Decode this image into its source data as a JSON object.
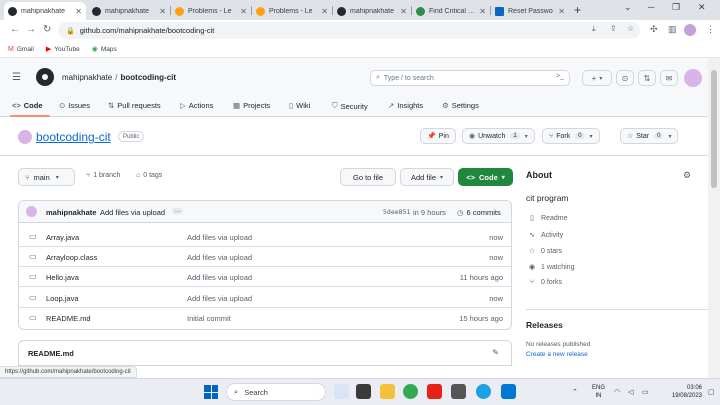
{
  "browser": {
    "tabs": [
      {
        "title": "mahipnakhate"
      },
      {
        "title": "mahipnakhate"
      },
      {
        "title": "Problems - Le"
      },
      {
        "title": "Problems - Le"
      },
      {
        "title": "mahipnakhate"
      },
      {
        "title": "Find Critical an"
      },
      {
        "title": "Reset Passwo"
      }
    ],
    "new_tab": "+",
    "url": "github.com/mahipnakhate/bootcoding-cit",
    "bookmarks": [
      {
        "label": "Gmail",
        "icon": "gmail-icon"
      },
      {
        "label": "YouTube",
        "icon": "youtube-icon"
      },
      {
        "label": "Maps",
        "icon": "maps-icon"
      }
    ],
    "status_url": "https://github.com/mahipnakhate/bootcoding-cit"
  },
  "github": {
    "owner": "mahipnakhate",
    "separator": "/",
    "repo": "bootcoding-cit",
    "search_placeholder": "Type / to search",
    "search_key": ">_",
    "plus": "+",
    "nav": [
      {
        "label": "Code",
        "icon": "<>"
      },
      {
        "label": "Issues",
        "icon": "⊙"
      },
      {
        "label": "Pull requests",
        "icon": "⇅"
      },
      {
        "label": "Actions",
        "icon": "▷"
      },
      {
        "label": "Projects",
        "icon": "▦"
      },
      {
        "label": "Wiki",
        "icon": "▯"
      },
      {
        "label": "Security",
        "icon": "⛉"
      },
      {
        "label": "Insights",
        "icon": "↗"
      },
      {
        "label": "Settings",
        "icon": "⚙"
      }
    ]
  },
  "repo": {
    "name": "bootcoding-cit",
    "visibility": "Public",
    "pin": "Pin",
    "unwatch": "Unwatch",
    "watch_count": "1",
    "fork": "Fork",
    "fork_count": "0",
    "star": "Star",
    "star_count": "0",
    "branch": "main",
    "branches": "1 branch",
    "tags": "0 tags",
    "go_to_file": "Go to file",
    "add_file": "Add file",
    "code_button": "Code"
  },
  "commit": {
    "user": "mahipnakhate",
    "message": "Add files via upload",
    "ellipsis": "...",
    "sha": "5dee851",
    "time": "in 9 hours",
    "count": "6 commits"
  },
  "files": [
    {
      "name": "Array.java",
      "message": "Add files via upload",
      "time": "now"
    },
    {
      "name": "Arrayloop.class",
      "message": "Add files via upload",
      "time": "now"
    },
    {
      "name": "Hello.java",
      "message": "Add files via upload",
      "time": "11 hours ago"
    },
    {
      "name": "Loop.java",
      "message": "Add files via upload",
      "time": "now"
    },
    {
      "name": "README.md",
      "message": "Initial commit",
      "time": "15 hours ago"
    }
  ],
  "readme": {
    "title": "README.md"
  },
  "about": {
    "title": "About",
    "description": "cit program",
    "items": [
      {
        "label": "Readme",
        "icon": "book-icon"
      },
      {
        "label": "Activity",
        "icon": "pulse-icon"
      },
      {
        "label": "0 stars",
        "icon": "star-icon"
      },
      {
        "label": "1 watching",
        "icon": "eye-icon"
      },
      {
        "label": "0 forks",
        "icon": "fork-icon"
      }
    ]
  },
  "releases": {
    "title": "Releases",
    "none": "No releases published",
    "create": "Create a new release"
  },
  "taskbar": {
    "search": "Search",
    "lang_top": "ENG",
    "lang_bottom": "IN",
    "time": "03:06",
    "date": "19/08/2023"
  },
  "colors": {
    "accent_link": "#0969da",
    "code_button": "#1f883d",
    "nav_underline": "#fd8c73"
  }
}
